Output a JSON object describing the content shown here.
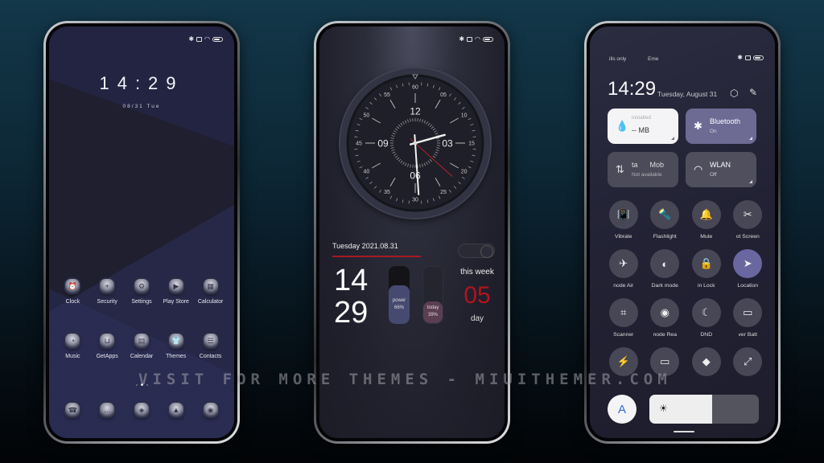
{
  "colors": {
    "accent_red": "#b0141d",
    "tile_purple": "#6d6a94",
    "location_active": "#6966a0",
    "auto_blue": "#2f6bd6"
  },
  "status_icons": [
    "bluetooth-icon",
    "sim-icon",
    "wifi-icon",
    "battery-icon"
  ],
  "phone1": {
    "lock_time": "14:29",
    "lock_date": "08/31  Tue",
    "apps_row1": [
      {
        "label": "Clock",
        "icon": "alarm-clock-icon",
        "glyph": "⏰"
      },
      {
        "label": "Security",
        "icon": "shield-icon",
        "glyph": "+"
      },
      {
        "label": "Settings",
        "icon": "gear-icon",
        "glyph": "⚙"
      },
      {
        "label": "Play Store",
        "icon": "play-icon",
        "glyph": "▶"
      },
      {
        "label": "Calculator",
        "icon": "calculator-icon",
        "glyph": "▦"
      }
    ],
    "apps_row2": [
      {
        "label": "Music",
        "icon": "music-disc-icon",
        "glyph": "◔"
      },
      {
        "label": "GetApps",
        "icon": "bag-icon",
        "glyph": "⊔"
      },
      {
        "label": "Calendar",
        "icon": "calendar-icon",
        "glyph": "▤"
      },
      {
        "label": "Themes",
        "icon": "tshirt-icon",
        "glyph": "👕"
      },
      {
        "label": "Contacts",
        "icon": "contact-card-icon",
        "glyph": "☰"
      }
    ],
    "dock": [
      {
        "icon": "phone-icon",
        "glyph": "☎"
      },
      {
        "icon": "message-icon",
        "glyph": "…"
      },
      {
        "icon": "tag-icon",
        "glyph": "◈"
      },
      {
        "icon": "gallery-icon",
        "glyph": "▲"
      },
      {
        "icon": "camera-icon",
        "glyph": "◉"
      }
    ],
    "page_count": 3,
    "active_page": 2
  },
  "phone2": {
    "clock": {
      "hour": 14,
      "minute": 29,
      "second": 22,
      "hour_labels": [
        "12",
        "03",
        "06",
        "09"
      ],
      "minute_labels": [
        "60",
        "05",
        "10",
        "15",
        "20",
        "25",
        "30",
        "35",
        "40",
        "45",
        "50",
        "55"
      ]
    },
    "date_line": "Tuesday 2021.08.31",
    "big_hour": "14",
    "big_minute": "29",
    "power": {
      "label": "power",
      "value_text": "66%",
      "value": 0.66
    },
    "today": {
      "label": "today",
      "value_text": "39%",
      "value": 0.39
    },
    "week_label": "this week",
    "week_num": "05",
    "day_label": "day"
  },
  "phone3": {
    "carrier_left": "ills only",
    "carrier_right": "Eme",
    "time": "14:29",
    "date": "Tuesday, August 31",
    "tiles": {
      "data": {
        "title": "-- MB",
        "sub": "installed",
        "icon": "water-drop-icon"
      },
      "bluetooth": {
        "title": "Bluetooth",
        "sub": "On",
        "icon": "bluetooth-icon"
      },
      "mobile": {
        "title": "ta      Mob",
        "sub": "Not available",
        "icon": "mobile-data-icon"
      },
      "wlan": {
        "title": "WLAN",
        "sub": "Off",
        "icon": "wifi-icon"
      }
    },
    "toggles": [
      {
        "label": "Vibrate",
        "icon": "vibrate-icon",
        "glyph": "📳",
        "active": false
      },
      {
        "label": "Flashlight",
        "icon": "flashlight-icon",
        "glyph": "🔦",
        "active": false
      },
      {
        "label": "Mute",
        "icon": "bell-icon",
        "glyph": "🔔",
        "active": false
      },
      {
        "label": "ot   Screen",
        "icon": "screenshot-icon",
        "glyph": "✂",
        "active": false
      },
      {
        "label": "node   Air",
        "icon": "airplane-icon",
        "glyph": "✈",
        "active": false
      },
      {
        "label": "Dark mode",
        "icon": "dark-mode-icon",
        "glyph": "◐",
        "active": false
      },
      {
        "label": "in   Lock",
        "icon": "lock-icon",
        "glyph": "🔒",
        "active": false
      },
      {
        "label": "Location",
        "icon": "location-arrow-icon",
        "glyph": "➤",
        "active": true
      },
      {
        "label": "Scanner",
        "icon": "scanner-icon",
        "glyph": "⌗",
        "active": false
      },
      {
        "label": "node   Rea",
        "icon": "eye-icon",
        "glyph": "◉",
        "active": false
      },
      {
        "label": "DND",
        "icon": "moon-icon",
        "glyph": "☾",
        "active": false
      },
      {
        "label": "ver   Batt",
        "icon": "battery-saver-icon",
        "glyph": "▭",
        "active": false
      },
      {
        "label": "",
        "icon": "lightning-icon",
        "glyph": "⚡",
        "active": false
      },
      {
        "label": "",
        "icon": "cast-screen-icon",
        "glyph": "▭",
        "active": false
      },
      {
        "label": "",
        "icon": "quick-share-icon",
        "glyph": "◆",
        "active": false
      },
      {
        "label": "",
        "icon": "expand-icon",
        "glyph": "⤢",
        "active": false
      }
    ],
    "auto_brightness_label": "A",
    "brightness": 0.57
  },
  "watermark": "VISIT FOR MORE THEMES - MIUITHEMER.COM"
}
